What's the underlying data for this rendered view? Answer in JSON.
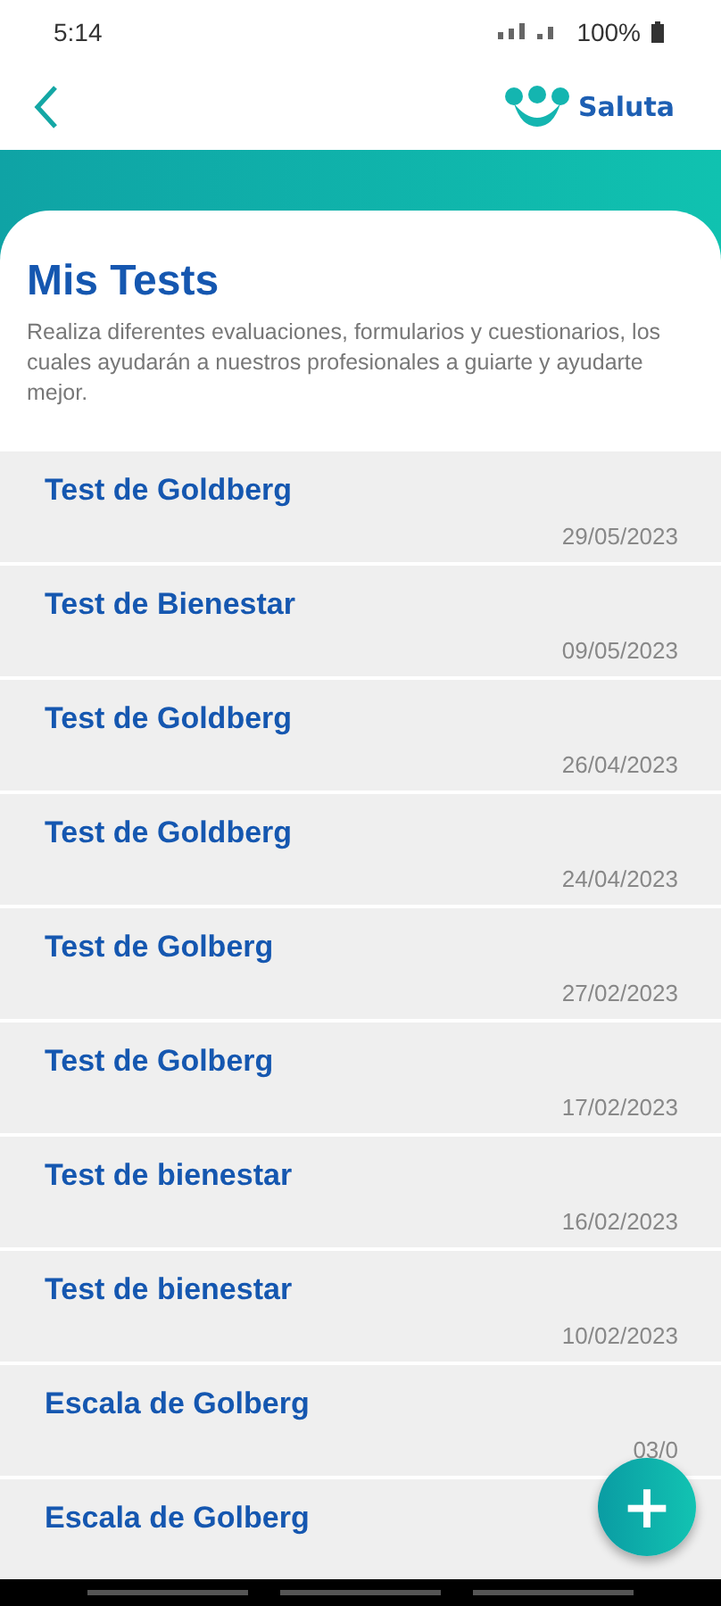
{
  "status_bar": {
    "time": "5:14",
    "battery": "100%"
  },
  "header": {
    "logo_text": "Saluta"
  },
  "intro": {
    "title": "Mis Tests",
    "description": "Realiza diferentes evaluaciones, formularios y cuestionarios, los cuales ayudarán a nuestros profesionales a guiarte y ayudarte mejor."
  },
  "tests": [
    {
      "name": "Test de Goldberg",
      "date": "29/05/2023"
    },
    {
      "name": "Test de Bienestar",
      "date": "09/05/2023"
    },
    {
      "name": "Test de Goldberg",
      "date": "26/04/2023"
    },
    {
      "name": "Test de Goldberg",
      "date": "24/04/2023"
    },
    {
      "name": "Test de Golberg",
      "date": "27/02/2023"
    },
    {
      "name": "Test de Golberg",
      "date": "17/02/2023"
    },
    {
      "name": "Test de bienestar",
      "date": "16/02/2023"
    },
    {
      "name": "Test de bienestar",
      "date": "10/02/2023"
    },
    {
      "name": "Escala de Golberg",
      "date": "03/0"
    },
    {
      "name": "Escala de Golberg"
    }
  ],
  "fab": {
    "label": "+"
  }
}
